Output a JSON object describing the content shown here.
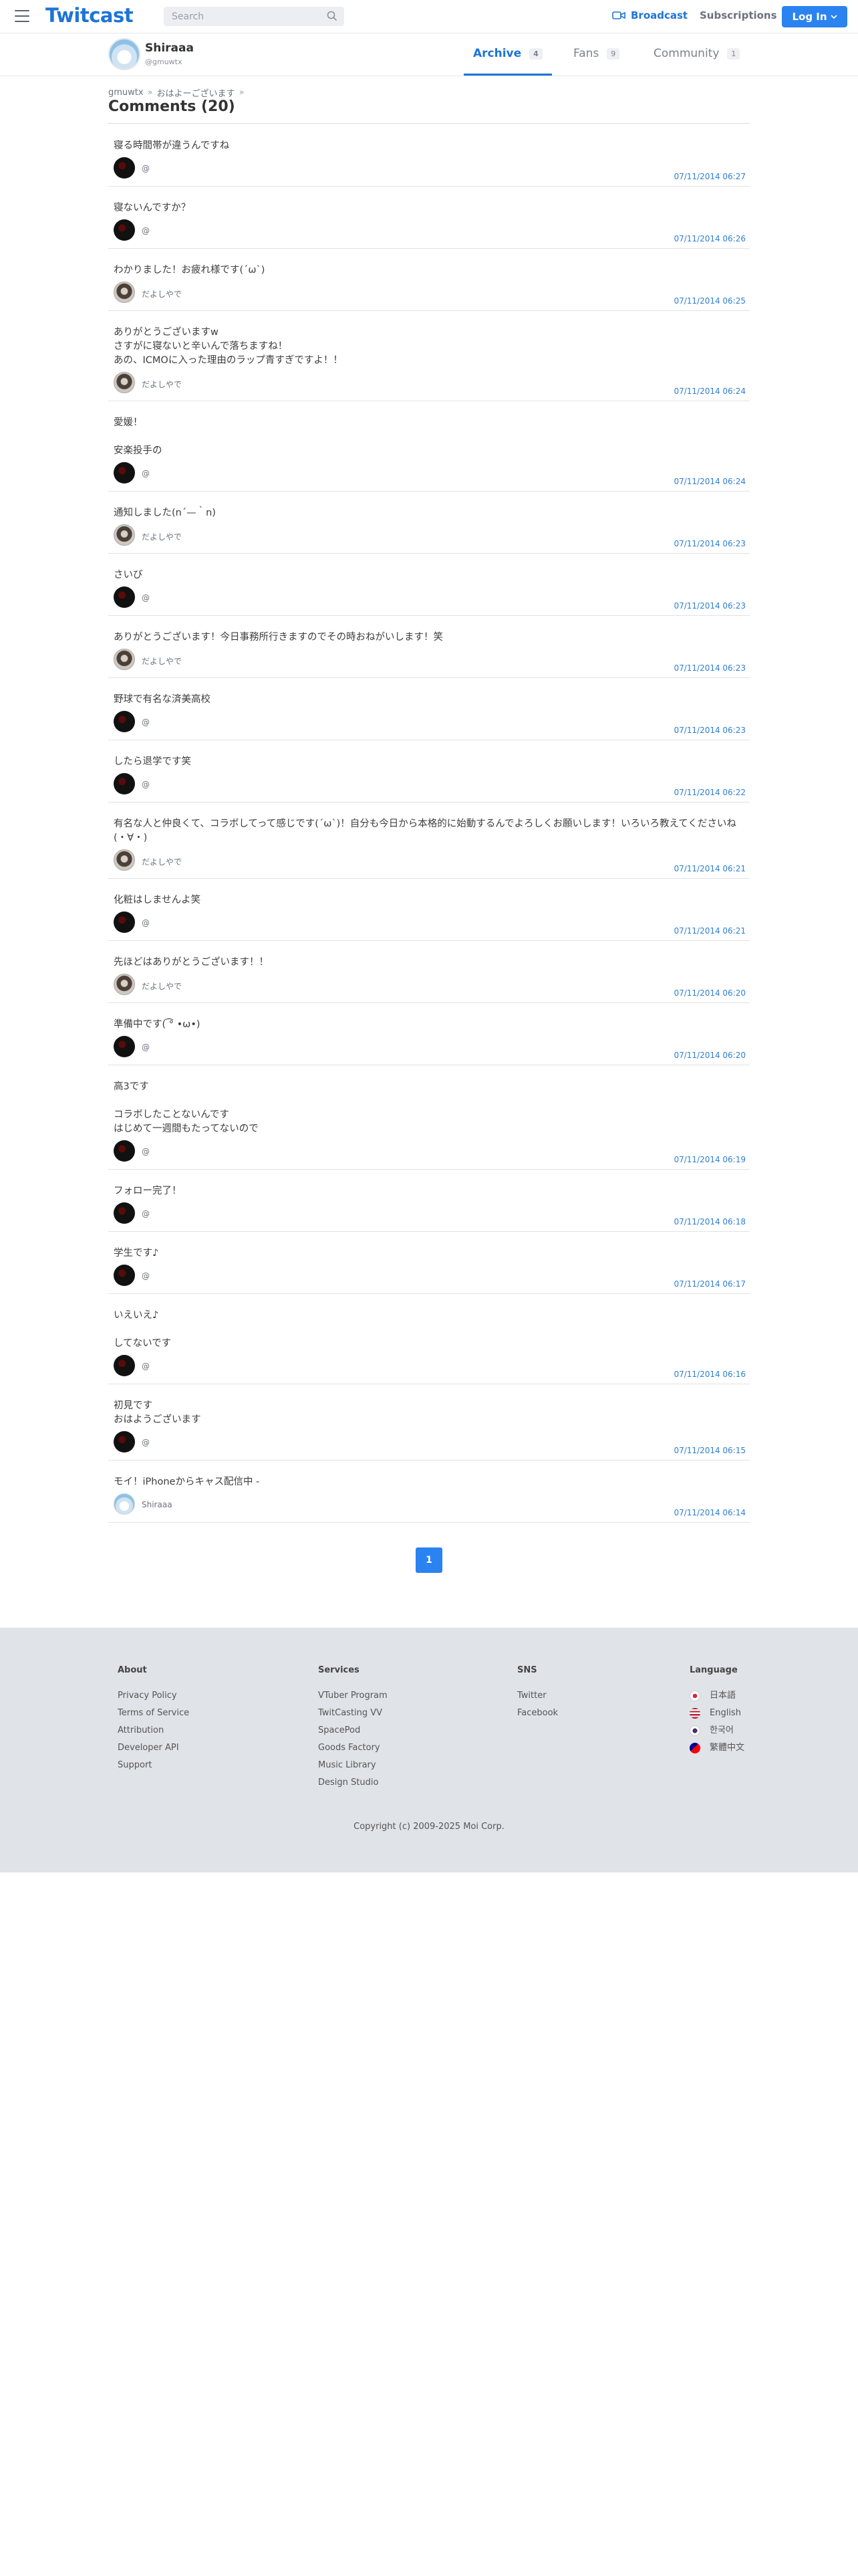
{
  "header": {
    "logo": "Twitcast",
    "search_placeholder": "Search",
    "broadcast": "Broadcast",
    "subscriptions": "Subscriptions",
    "login": "Log In",
    "accent": "#1e74d6",
    "login_bg": "#2a83f0"
  },
  "profile": {
    "name": "Shiraaa",
    "handle": "@gmuwtx",
    "tabs": [
      {
        "label": "Archive",
        "count": "4"
      },
      {
        "label": "Fans",
        "count": "9"
      },
      {
        "label": "Community",
        "count": "1"
      }
    ]
  },
  "breadcrumb": [
    "gmuwtx",
    "»",
    "おはよーございます",
    "»"
  ],
  "title": "Comments (20)",
  "comments": [
    {
      "lines": [
        "寝る時間帯が違うんですね"
      ],
      "author": "@",
      "avatar": "dark",
      "date": "07/11/2014 06:27"
    },
    {
      "lines": [
        "寝ないんですか？"
      ],
      "author": "@",
      "avatar": "dark",
      "date": "07/11/2014 06:26"
    },
    {
      "lines": [
        "わかりました！お疲れ様です(´ω`)"
      ],
      "author": "だよしやで",
      "avatar": "photo",
      "date": "07/11/2014 06:25"
    },
    {
      "lines": [
        "ありがとうございますw",
        "さすがに寝ないと辛いんで落ちますね！",
        "あの、ICMOに入った理由のラップ青すぎですよ！！"
      ],
      "author": "だよしやで",
      "avatar": "photo",
      "date": "07/11/2014 06:24"
    },
    {
      "lines": [
        "愛媛！",
        "",
        "安楽投手の"
      ],
      "author": "@",
      "avatar": "dark",
      "date": "07/11/2014 06:24"
    },
    {
      "lines": [
        "通知しました(n´—｀n)"
      ],
      "author": "だよしやで",
      "avatar": "photo",
      "date": "07/11/2014 06:23"
    },
    {
      "lines": [
        "さいび"
      ],
      "author": "@",
      "avatar": "dark",
      "date": "07/11/2014 06:23"
    },
    {
      "lines": [
        "ありがとうございます！今日事務所行きますのでその時おねがいします！笑"
      ],
      "author": "だよしやで",
      "avatar": "photo",
      "date": "07/11/2014 06:23"
    },
    {
      "lines": [
        "野球で有名な済美高校"
      ],
      "author": "@",
      "avatar": "dark",
      "date": "07/11/2014 06:23"
    },
    {
      "lines": [
        "したら退学です笑"
      ],
      "author": "@",
      "avatar": "dark",
      "date": "07/11/2014 06:22"
    },
    {
      "lines": [
        "有名な人と仲良くて、コラボしてって感じです(´ω`)！自分も今日から本格的に始動するんでよろしくお願いします！いろいろ教えてくださいね",
        "(・∀・)"
      ],
      "author": "だよしやで",
      "avatar": "photo",
      "date": "07/11/2014 06:21"
    },
    {
      "lines": [
        "化粧はしませんよ笑"
      ],
      "author": "@",
      "avatar": "dark",
      "date": "07/11/2014 06:21"
    },
    {
      "lines": [
        "先ほどはありがとうございます！！"
      ],
      "author": "だよしやで",
      "avatar": "photo",
      "date": "07/11/2014 06:20"
    },
    {
      "lines": [
        "準備中です( ͡° •ω•)"
      ],
      "author": "@",
      "avatar": "dark",
      "date": "07/11/2014 06:20"
    },
    {
      "lines": [
        "高3です",
        "",
        "コラボしたことないんです",
        "はじめて一週間もたってないので"
      ],
      "author": "@",
      "avatar": "dark",
      "date": "07/11/2014 06:19"
    },
    {
      "lines": [
        "フォロー完了！"
      ],
      "author": "@",
      "avatar": "dark",
      "date": "07/11/2014 06:18"
    },
    {
      "lines": [
        "学生です♪"
      ],
      "author": "@",
      "avatar": "dark",
      "date": "07/11/2014 06:17"
    },
    {
      "lines": [
        "いえいえ♪",
        "",
        "してないです"
      ],
      "author": "@",
      "avatar": "dark",
      "date": "07/11/2014 06:16"
    },
    {
      "lines": [
        "初見です",
        "おはようございます"
      ],
      "author": "@",
      "avatar": "dark",
      "date": "07/11/2014 06:15"
    },
    {
      "lines": [
        "モイ！iPhoneからキャス配信中 -"
      ],
      "author": "Shiraaa",
      "avatar": "light",
      "date": "07/11/2014 06:14"
    }
  ],
  "pagination": {
    "current": "1"
  },
  "footer": {
    "about": {
      "title": "About",
      "links": [
        "Privacy Policy",
        "Terms of Service",
        "Attribution",
        "Developer API",
        "Support"
      ]
    },
    "services": {
      "title": "Services",
      "links": [
        "VTuber Program",
        "TwitCasting VV",
        "SpacePod",
        "Goods Factory",
        "Music Library",
        "Design Studio"
      ]
    },
    "sns": {
      "title": "SNS",
      "links": [
        "Twitter",
        "Facebook"
      ]
    },
    "language": {
      "title": "Language",
      "links": [
        "日本語",
        "English",
        "한국어",
        "繁體中文"
      ]
    },
    "copyright": "Copyright (c) 2009-2025 Moi Corp."
  }
}
